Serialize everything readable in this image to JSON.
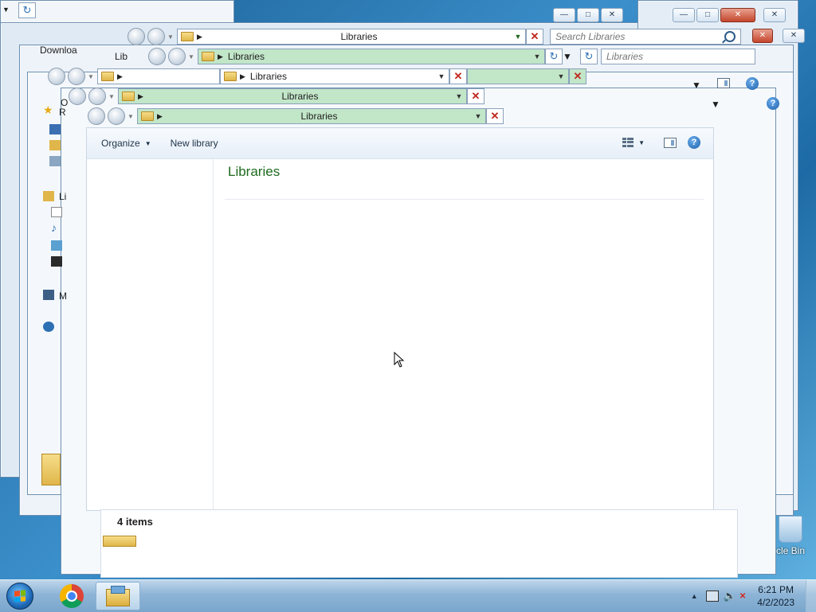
{
  "window": {
    "address_title": "Libraries",
    "search_placeholder": "Search Libraries",
    "search_placeholder_short": "Libraries"
  },
  "toolbar": {
    "organize_label": "Organize",
    "new_library_label": "New library"
  },
  "content": {
    "heading": "Libraries"
  },
  "details": {
    "item_count": "4 items"
  },
  "ghost_labels": {
    "downloads_fragment": "Downloa",
    "lib_fragment_1": "Lib",
    "lib_fragment_2": "Li",
    "o_fragment": "O",
    "r_fragment": "R",
    "m_fragment": "M"
  },
  "desktop": {
    "recycle_bin_label": "cle Bin"
  },
  "taskbar": {
    "time": "6:21 PM",
    "date": "4/2/2023"
  },
  "colors": {
    "heading_green": "#1e6a1e",
    "address_highlight": "#c2e6c8",
    "close_red": "#c4452c"
  }
}
